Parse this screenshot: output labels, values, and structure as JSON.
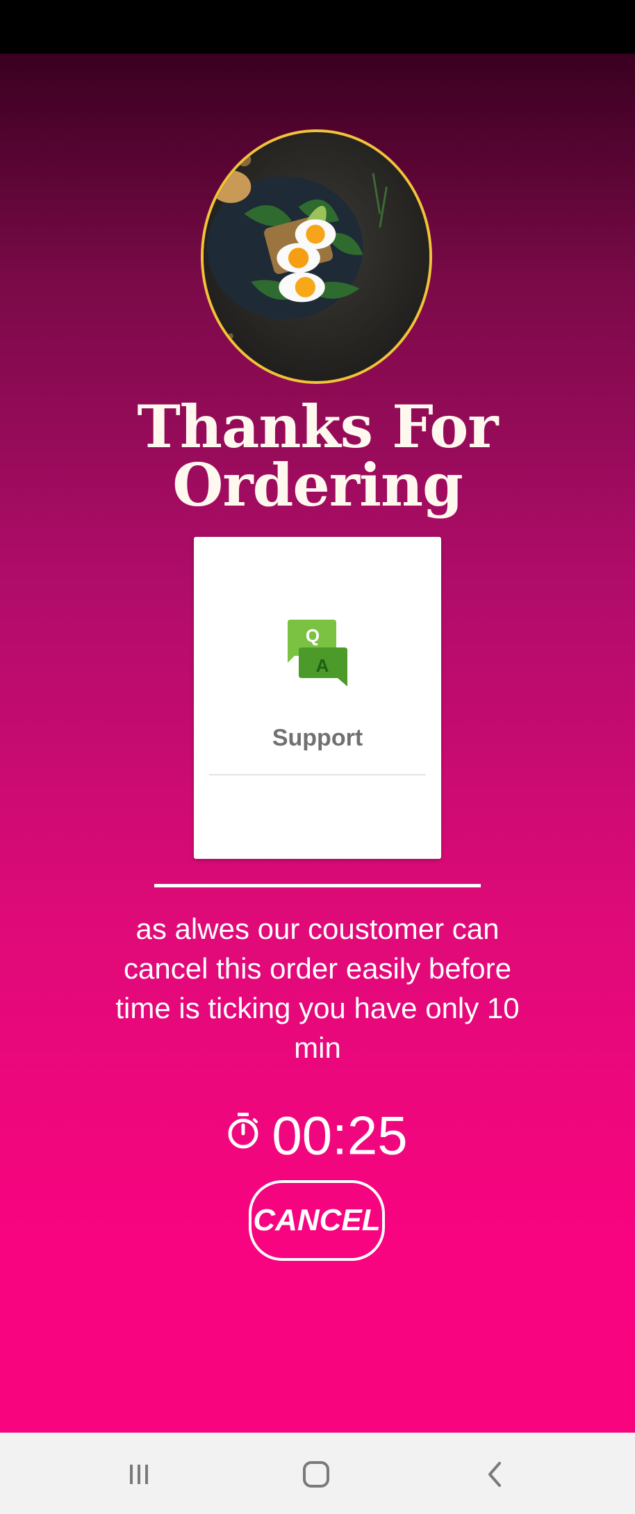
{
  "page": {
    "title": "Thanks For Ordering"
  },
  "support_card": {
    "icon": "qa-chat-icon",
    "label": "Support"
  },
  "message": {
    "text": "as alwes our coustomer can cancel this order easily before time is ticking you have only 10 min"
  },
  "timer": {
    "icon": "stopwatch-icon",
    "value": "00:25"
  },
  "actions": {
    "cancel_label": "CANCEL"
  },
  "nav_bar": {
    "recent": "recent-apps-icon",
    "home": "home-icon",
    "back": "back-icon"
  },
  "colors": {
    "gradient_top": "#3a0020",
    "gradient_bottom": "#f8047f",
    "avatar_border": "#f2c338",
    "card_bg": "#ffffff",
    "support_text": "#707070",
    "qa_light_green": "#7cc242",
    "qa_dark_green": "#4c9a2a"
  }
}
